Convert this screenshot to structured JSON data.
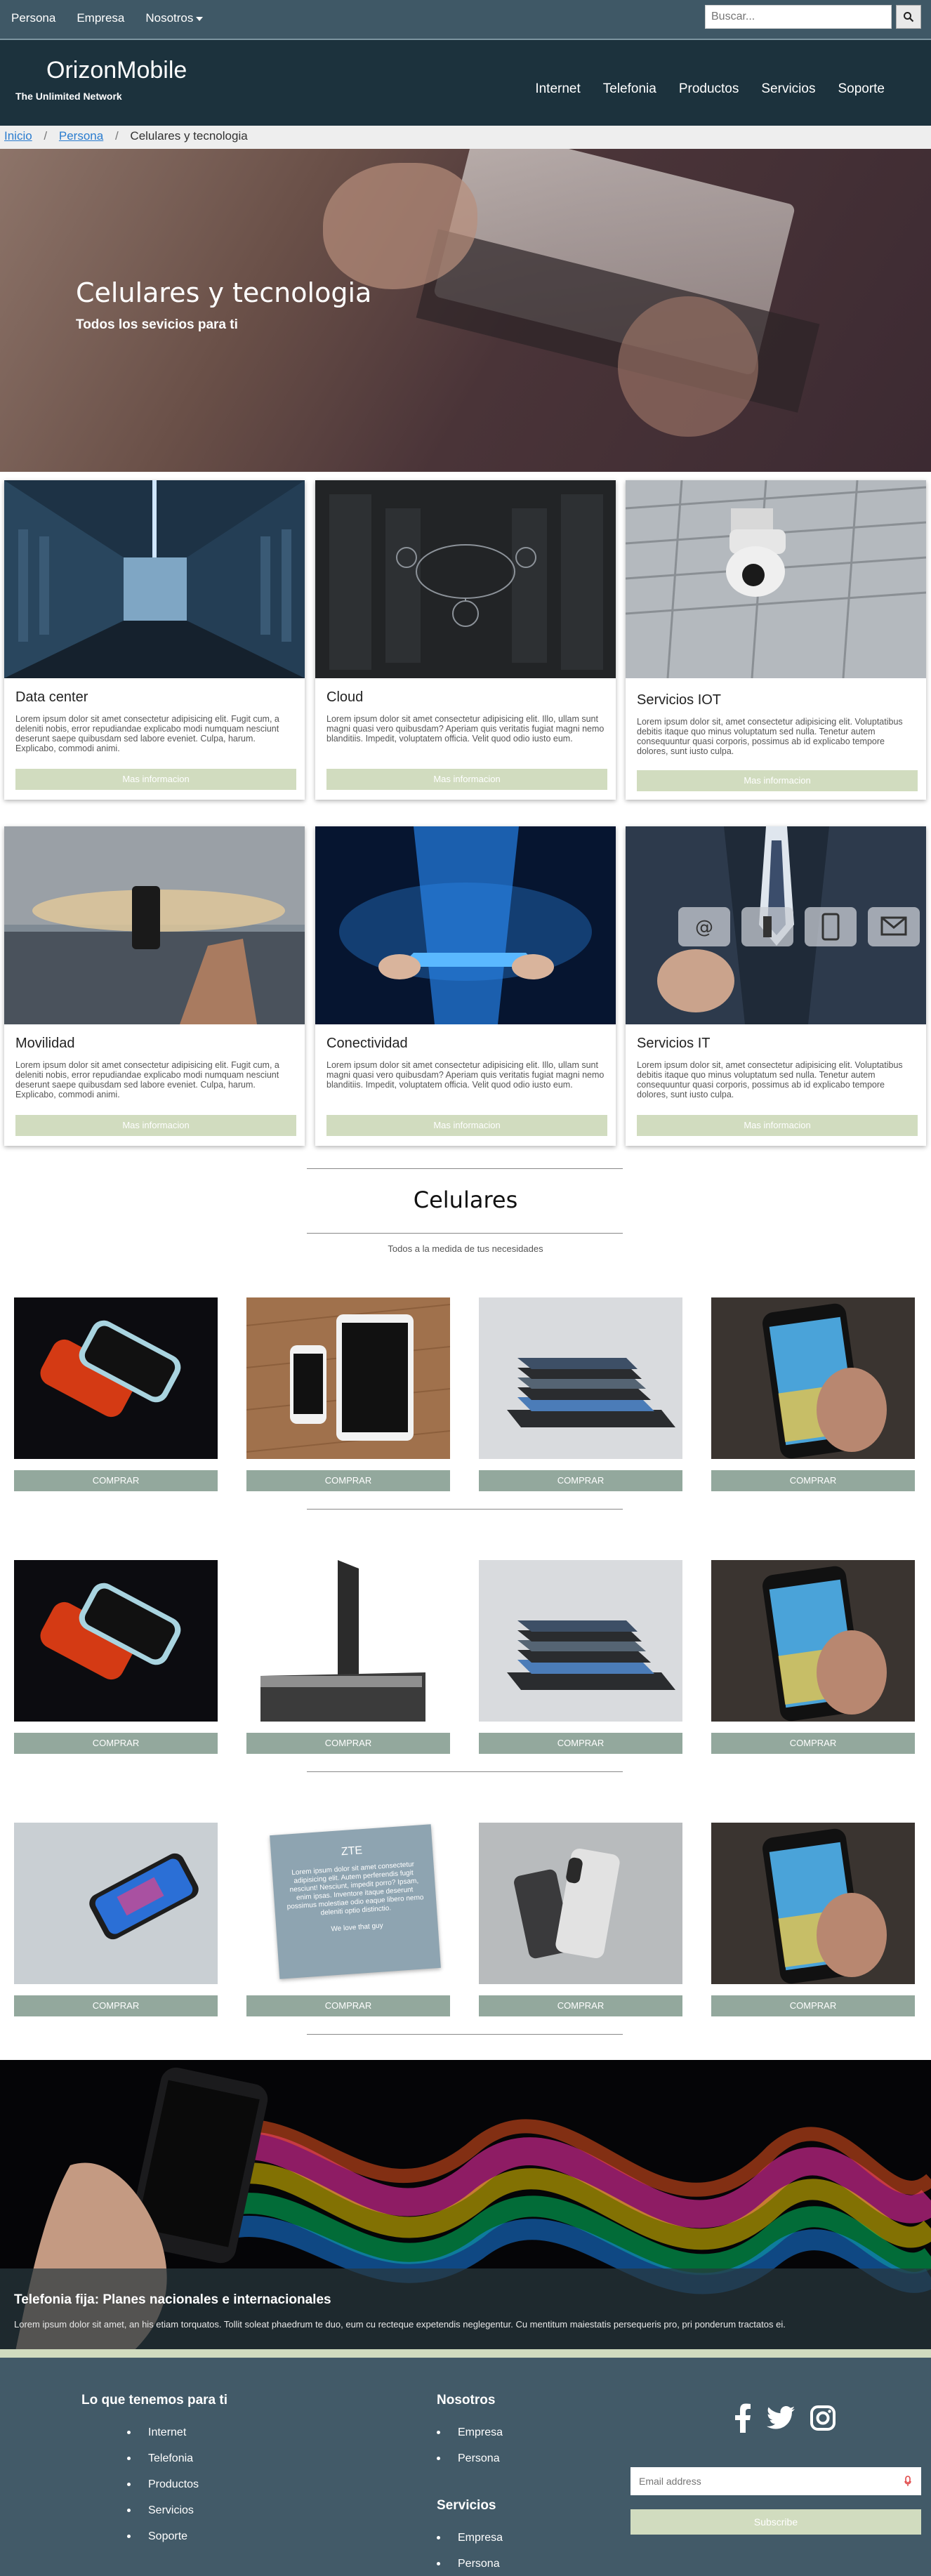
{
  "topbar": {
    "links": [
      "Persona",
      "Empresa",
      "Nosotros"
    ],
    "search_placeholder": "Buscar..."
  },
  "header": {
    "brand": "OrizonMobile",
    "tagline": "The Unlimited Network",
    "nav": [
      "Internet",
      "Telefonia",
      "Productos",
      "Servicios",
      "Soporte"
    ]
  },
  "breadcrumb": {
    "home": "Inicio",
    "persona": "Persona",
    "current": "Celulares y tecnologia",
    "sep": "/"
  },
  "hero": {
    "title": "Celulares y tecnologia",
    "subtitle": "Todos los sevicios para ti"
  },
  "cards": [
    {
      "title": "Data center",
      "text": "Lorem ipsum dolor sit amet consectetur adipisicing elit. Fugit cum, a deleniti nobis, error repudiandae explicabo modi numquam nesciunt deserunt saepe quibusdam sed labore eveniet. Culpa, harum. Explicabo, commodi animi.",
      "button": "Mas informacion"
    },
    {
      "title": "Cloud",
      "text": "Lorem ipsum dolor sit amet consectetur adipisicing elit. Illo, ullam sunt magni quasi vero quibusdam? Aperiam quis veritatis fugiat magni nemo blanditiis. Impedit, voluptatem officia. Velit quod odio iusto eum.",
      "button": "Mas informacion"
    },
    {
      "title": "Servicios IOT",
      "text": "Lorem ipsum dolor sit, amet consectetur adipisicing elit. Voluptatibus debitis itaque quo minus voluptatum sed nulla. Tenetur autem consequuntur quasi corporis, possimus ab id explicabo tempore dolores, sunt iusto culpa.",
      "button": "Mas informacion"
    },
    {
      "title": "Movilidad",
      "text": "Lorem ipsum dolor sit amet consectetur adipisicing elit. Fugit cum, a deleniti nobis, error repudiandae explicabo modi numquam nesciunt deserunt saepe quibusdam sed labore eveniet. Culpa, harum. Explicabo, commodi animi.",
      "button": "Mas informacion"
    },
    {
      "title": "Conectividad",
      "text": "Lorem ipsum dolor sit amet consectetur adipisicing elit. Illo, ullam sunt magni quasi vero quibusdam? Aperiam quis veritatis fugiat magni nemo blanditiis. Impedit, voluptatem officia. Velit quod odio iusto eum.",
      "button": "Mas informacion"
    },
    {
      "title": "Servicios IT",
      "text": "Lorem ipsum dolor sit, amet consectetur adipisicing elit. Voluptatibus debitis itaque quo minus voluptatum sed nulla. Tenetur autem consequuntur quasi corporis, possimus ab id explicabo tempore dolores, sunt iusto culpa.",
      "button": "Mas informacion"
    }
  ],
  "celulares": {
    "title": "Celulares",
    "subtitle": "Todos a la medida de tus necesidades",
    "buy_label": "COMPRAR",
    "zte_card": {
      "brand": "ZTE",
      "text": "Lorem ipsum dolor sit amet consectetur adipisicing elit. Autem perferendis fugit nesciunt! Nesciunt, impedit porro? Ipsam, enim ipsas. Inventore itaque deserunt possimus molestiae odio eaque libero nemo deleniti optio distinctio.",
      "footer": "We love that guy"
    }
  },
  "banner": {
    "title": "Telefonia fija: Planes nacionales e internacionales",
    "text": "Lorem ipsum dolor sit amet, an his etiam torquatos. Tollit soleat phaedrum te duo, eum cu recteque expetendis neglegentur. Cu mentitum maiestatis persequeris pro, pri ponderum tractatos ei."
  },
  "footer": {
    "col1_title": "Lo que tenemos para ti",
    "col1_items": [
      "Internet",
      "Telefonia",
      "Productos",
      "Servicios",
      "Soporte"
    ],
    "col2_title": "Nosotros",
    "col2_items": [
      "Empresa",
      "Persona"
    ],
    "col3_title": "Servicios",
    "col3_items": [
      "Empresa",
      "Persona"
    ],
    "email_placeholder": "Email address",
    "subscribe": "Subscribe",
    "social_icons": [
      "facebook-icon",
      "twitter-icon",
      "instagram-icon"
    ]
  },
  "colors": {
    "topbar": "#3f5866",
    "header": "#1c323d",
    "card_button": "#d1dcbf",
    "buy_button": "#93a89d",
    "footer": "#425a68"
  }
}
